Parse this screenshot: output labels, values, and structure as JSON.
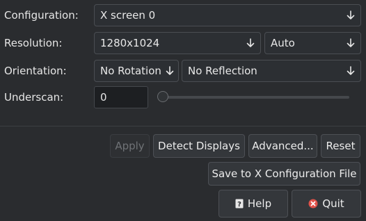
{
  "labels": {
    "configuration": "Configuration:",
    "resolution": "Resolution:",
    "orientation": "Orientation:",
    "underscan": "Underscan:"
  },
  "configuration": {
    "value": "X screen 0"
  },
  "resolution": {
    "value": "1280x1024",
    "refresh": "Auto"
  },
  "orientation": {
    "rotation": "No Rotation",
    "reflection": "No Reflection"
  },
  "underscan": {
    "value": "0",
    "slider_fraction": 0
  },
  "buttons": {
    "apply": "Apply",
    "detect_displays": "Detect Displays",
    "advanced": "Advanced...",
    "reset": "Reset",
    "save_x_config": "Save to X Configuration File",
    "help": "Help",
    "quit": "Quit"
  },
  "icons": {
    "dropdown": "arrow-down-icon",
    "help": "help-icon",
    "quit": "quit-icon"
  },
  "colors": {
    "background": "#2a2c2f",
    "quit_icon": "#e0524a"
  }
}
